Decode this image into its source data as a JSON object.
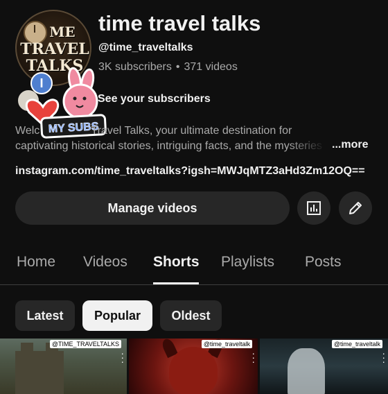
{
  "channel": {
    "title": "time travel talks",
    "handle": "@time_traveltalks",
    "subscribers": "3K subscribers",
    "videos": "371 videos",
    "meta_separator": "•",
    "avatar_text": [
      "ME",
      "TRAVEL",
      "TALKS"
    ],
    "see_subscribers": "See your subscribers",
    "sticker_text": "MY SUBS",
    "badge_letter": "I"
  },
  "description": {
    "line1_start": "Welc",
    "line1_end": " Travel Talks, your ultimate destination for",
    "line2": "captivating historical stories, intriguing facts, and the mysteries",
    "more": "...more"
  },
  "link": "instagram.com/time_traveltalks?igsh=MWJqMTZ3aHd3Zm12OQ==",
  "actions": {
    "manage_videos": "Manage videos",
    "analytics_icon": "bar-chart-icon",
    "edit_icon": "pencil-icon"
  },
  "tabs": [
    {
      "label": "Home"
    },
    {
      "label": "Videos"
    },
    {
      "label": "Shorts"
    },
    {
      "label": "Playlists"
    },
    {
      "label": "Posts"
    }
  ],
  "active_tab": "Shorts",
  "chips": [
    {
      "label": "Latest"
    },
    {
      "label": "Popular"
    },
    {
      "label": "Oldest"
    }
  ],
  "selected_chip": "Popular",
  "shorts": [
    {
      "label": "@TIME_TRAVELTALKS"
    },
    {
      "label": "@time_traveltalk"
    },
    {
      "label": "@time_traveltalk"
    }
  ],
  "colors": {
    "background": "#0f0f0f",
    "surface": "#272727",
    "text": "#f1f1f1",
    "secondary_text": "#aaaaaa"
  }
}
